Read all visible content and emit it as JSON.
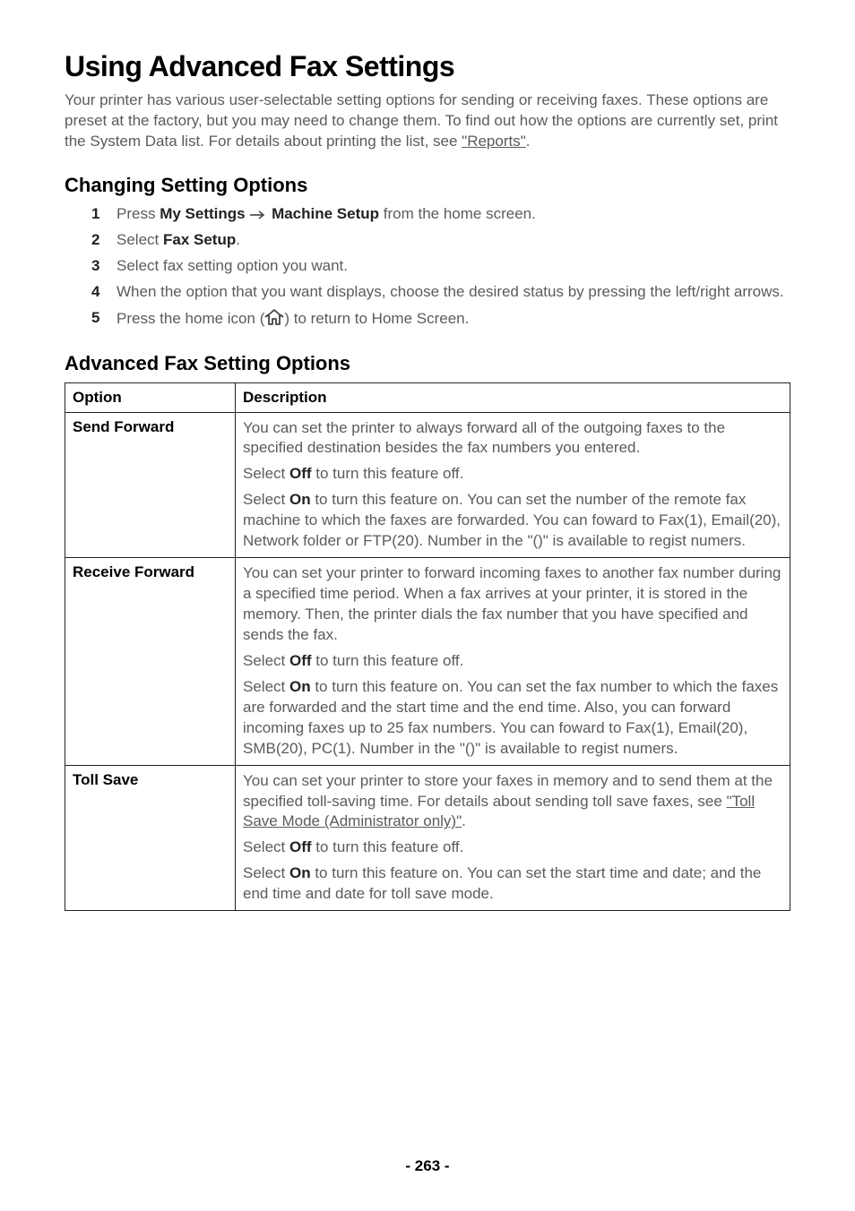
{
  "title": "Using Advanced Fax Settings",
  "intro_text": "Your printer has various user-selectable setting options for sending or receiving faxes. These options are preset at the factory, but you may need to change them. To find out how the options are currently set, print the System Data list. For details about printing the list, see ",
  "intro_link": "\"Reports\"",
  "intro_after": ".",
  "h2_changing": "Changing Setting Options",
  "steps": [
    {
      "num": "1",
      "pre": "Press ",
      "b1": "My Settings",
      "mid": "",
      "b2": "Machine Setup",
      "post": " from the home screen.",
      "arrow": true
    },
    {
      "num": "2",
      "pre": "Select ",
      "b1": "Fax Setup",
      "post": ".",
      "arrow": false
    },
    {
      "num": "3",
      "pre": "Select fax setting option you want.",
      "arrow": false
    },
    {
      "num": "4",
      "pre": "When the option that you want displays, choose the desired status by pressing the left/right arrows.",
      "arrow": false
    },
    {
      "num": "5",
      "pre": "Press the home icon (",
      "icon": true,
      "post": ") to return to Home Screen.",
      "arrow": false
    }
  ],
  "h2_advanced": "Advanced Fax Setting Options",
  "table_head_option": "Option",
  "table_head_desc": "Description",
  "rows": [
    {
      "option": "Send Forward",
      "desc": {
        "p1": "You can set the printer to always forward all of the outgoing faxes to the specified destination besides the fax numbers you entered.",
        "p2_pre": "Select ",
        "p2_b": "Off",
        "p2_post": " to turn this feature off.",
        "p3_pre": "Select ",
        "p3_b": "On",
        "p3_post": " to turn this feature on. You can set the number of the remote fax machine to which the faxes are forwarded. You can foward to Fax(1), Email(20), Network folder or FTP(20). Number in the \"()\" is available to regist numers."
      }
    },
    {
      "option": "Receive Forward",
      "desc": {
        "p1": "You can set your printer to forward incoming faxes to another fax number during a specified time period. When a fax arrives at your printer, it is stored in the memory. Then, the printer dials the fax number that you have specified and sends the fax.",
        "p2_pre": "Select ",
        "p2_b": "Off",
        "p2_post": " to turn this feature off.",
        "p3_pre": "Select ",
        "p3_b": "On",
        "p3_post": " to turn this feature on. You can set the fax number to which the faxes are forwarded and the start time and the end time. Also, you can forward incoming faxes up to 25 fax numbers. You can foward to Fax(1), Email(20), SMB(20), PC(1). Number in the \"()\" is available to regist numers."
      }
    },
    {
      "option": "Toll Save",
      "desc": {
        "p1_pre": "You can set your printer to store your faxes in memory and to send them at the specified toll-saving time. For details about sending toll save faxes, see ",
        "p1_link": "\"Toll Save Mode (Administrator only)\"",
        "p1_post": ".",
        "p2_pre": "Select ",
        "p2_b": "Off",
        "p2_post": " to turn this feature off.",
        "p3_pre": "Select ",
        "p3_b": "On",
        "p3_post": " to turn this feature on. You can set the start time and date; and the end time and date for toll save mode."
      }
    }
  ],
  "page_number": "- 263 -"
}
